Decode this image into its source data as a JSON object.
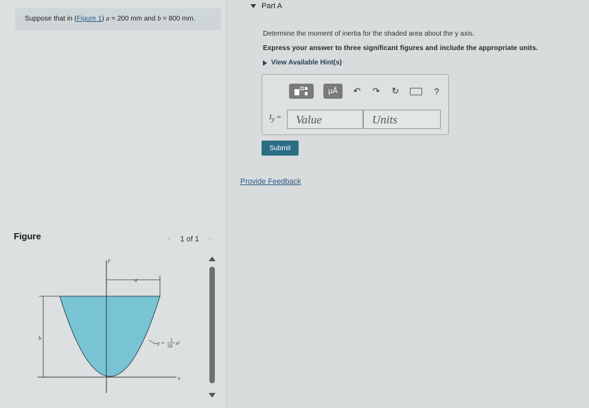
{
  "problem": {
    "prefix": "Suppose that in (",
    "link": "Figure 1",
    "suffix": ")",
    "a_var": "a",
    "a_value": " = 200 mm and ",
    "b_var": "b",
    "b_value": " = 800 mm."
  },
  "figure": {
    "title": "Figure",
    "pager": "1 of 1",
    "label_y": "y",
    "label_x": "x",
    "label_a": "a",
    "label_b": "b",
    "eq_y": "y =",
    "eq_num": "1",
    "eq_den": "50",
    "eq_x2": "x²",
    "colors": {
      "shaded": "#78c3d4"
    }
  },
  "part": {
    "header": "Part A",
    "question": "Determine the moment of inertia for the shaded area about the y axis.",
    "instruction": "Express your answer to three significant figures and include the appropriate units.",
    "hints": "View Available Hint(s)"
  },
  "answer": {
    "label": "I",
    "label_sub": "y",
    "label_eq": " =",
    "value_placeholder": "Value",
    "units_placeholder": "Units",
    "toolbar": {
      "templates_icon": "templates-icon",
      "mu_label": "μÅ",
      "help_label": "?"
    }
  },
  "buttons": {
    "submit": "Submit",
    "feedback": "Provide Feedback"
  },
  "colors": {
    "submit": "#2c6d86",
    "link": "#2a5a8a"
  }
}
